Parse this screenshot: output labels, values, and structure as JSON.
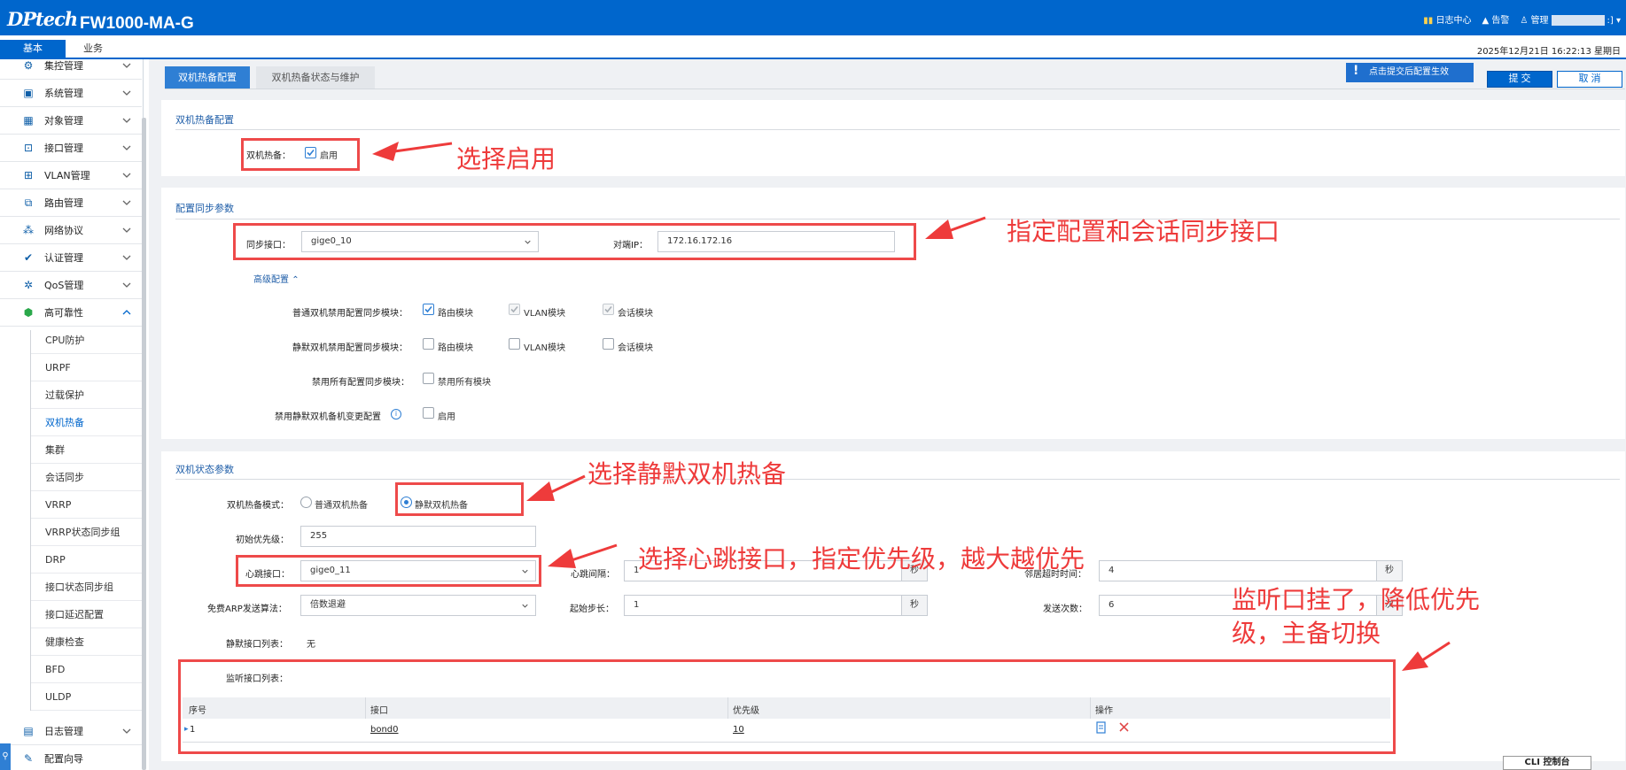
{
  "header": {
    "logo": "DPtech",
    "model": "FW1000-MA-G",
    "log_center": "日志中心",
    "alarm": "告警",
    "admin": "管理",
    "admin_suffix": ":]"
  },
  "nav": {
    "tabs": [
      "基本",
      "业务"
    ]
  },
  "datetime": "2025年12月21日   16:22:13   星期日",
  "sidebar": {
    "menus": [
      "集控管理",
      "系统管理",
      "对象管理",
      "接口管理",
      "VLAN管理",
      "路由管理",
      "网络协议",
      "认证管理",
      "QoS管理",
      "高可靠性"
    ],
    "sub_items": [
      "CPU防护",
      "URPF",
      "过载保护",
      "双机热备",
      "集群",
      "会话同步",
      "VRRP",
      "VRRP状态同步组",
      "DRP",
      "接口状态同步组",
      "接口延迟配置",
      "健康检查",
      "BFD",
      "ULDP"
    ],
    "active_sub": "双机热备",
    "bottom_menus": [
      "日志管理",
      "配置向导"
    ]
  },
  "tabs": [
    "双机热备配置",
    "双机热备状态与维护"
  ],
  "notice": "点击提交后配置生效",
  "buttons": {
    "submit": "提 交",
    "cancel": "取 消"
  },
  "ha_config": {
    "title": "双机热备配置",
    "label": "双机热备：",
    "enable_label": "启用",
    "enabled": true
  },
  "sync": {
    "title": "配置同步参数",
    "sync_iface_label": "同步接口：",
    "sync_iface": "gige0_10",
    "peer_ip_label": "对端IP：",
    "peer_ip": "172.16.172.16",
    "advanced": "高级配置",
    "normal_label": "普通双机禁用配置同步模块：",
    "silent_label": "静默双机禁用配置同步模块：",
    "all_label": "禁用所有配置同步模块：",
    "change_label": "禁用静默双机备机变更配置",
    "modules": [
      "路由模块",
      "VLAN模块",
      "会话模块"
    ],
    "normal_checked": [
      true,
      true,
      true
    ],
    "normal_disabled": [
      false,
      true,
      true
    ],
    "silent_checked": [
      false,
      false,
      false
    ],
    "all_option": "禁用所有模块",
    "change_option": "启用"
  },
  "state": {
    "title": "双机状态参数",
    "mode_label": "双机热备模式：",
    "mode_normal": "普通双机热备",
    "mode_silent": "静默双机热备",
    "selected_mode": "静默双机热备",
    "init_priority_label": "初始优先级：",
    "init_priority": "255",
    "heartbeat_label": "心跳接口：",
    "heartbeat": "gige0_11",
    "hb_interval_label": "心跳间隔：",
    "hb_interval": "1",
    "neighbor_timeout_label": "邻居超时时间：",
    "neighbor_timeout": "4",
    "arp_label": "免费ARP发送算法：",
    "arp": "倍数退避",
    "start_step_label": "起始步长：",
    "start_step": "1",
    "send_count_label": "发送次数：",
    "send_count": "6",
    "unit_sec": "秒",
    "unit_times": "次",
    "silent_iface_label": "静默接口列表：",
    "silent_iface": "无",
    "monitor_label": "监听接口列表："
  },
  "monitor_table": {
    "headers": [
      "序号",
      "接口",
      "优先级",
      "操作"
    ],
    "rows": [
      {
        "index": "1",
        "iface": "bond0",
        "priority": "10"
      }
    ]
  },
  "annotations": {
    "a1": "选择启用",
    "a2": "指定配置和会话同步接口",
    "a3": "选择静默双机热备",
    "a4": "选择心跳接口，指定优先级，越大越优先",
    "a5_line1": "监听口挂了，降低优先",
    "a5_line2": "级，主备切换"
  },
  "cli": "CLI 控制台",
  "colors": {
    "brand": "#0066cc",
    "annotation": "#ee3b3b",
    "panel_bg": "#eff1f4"
  }
}
